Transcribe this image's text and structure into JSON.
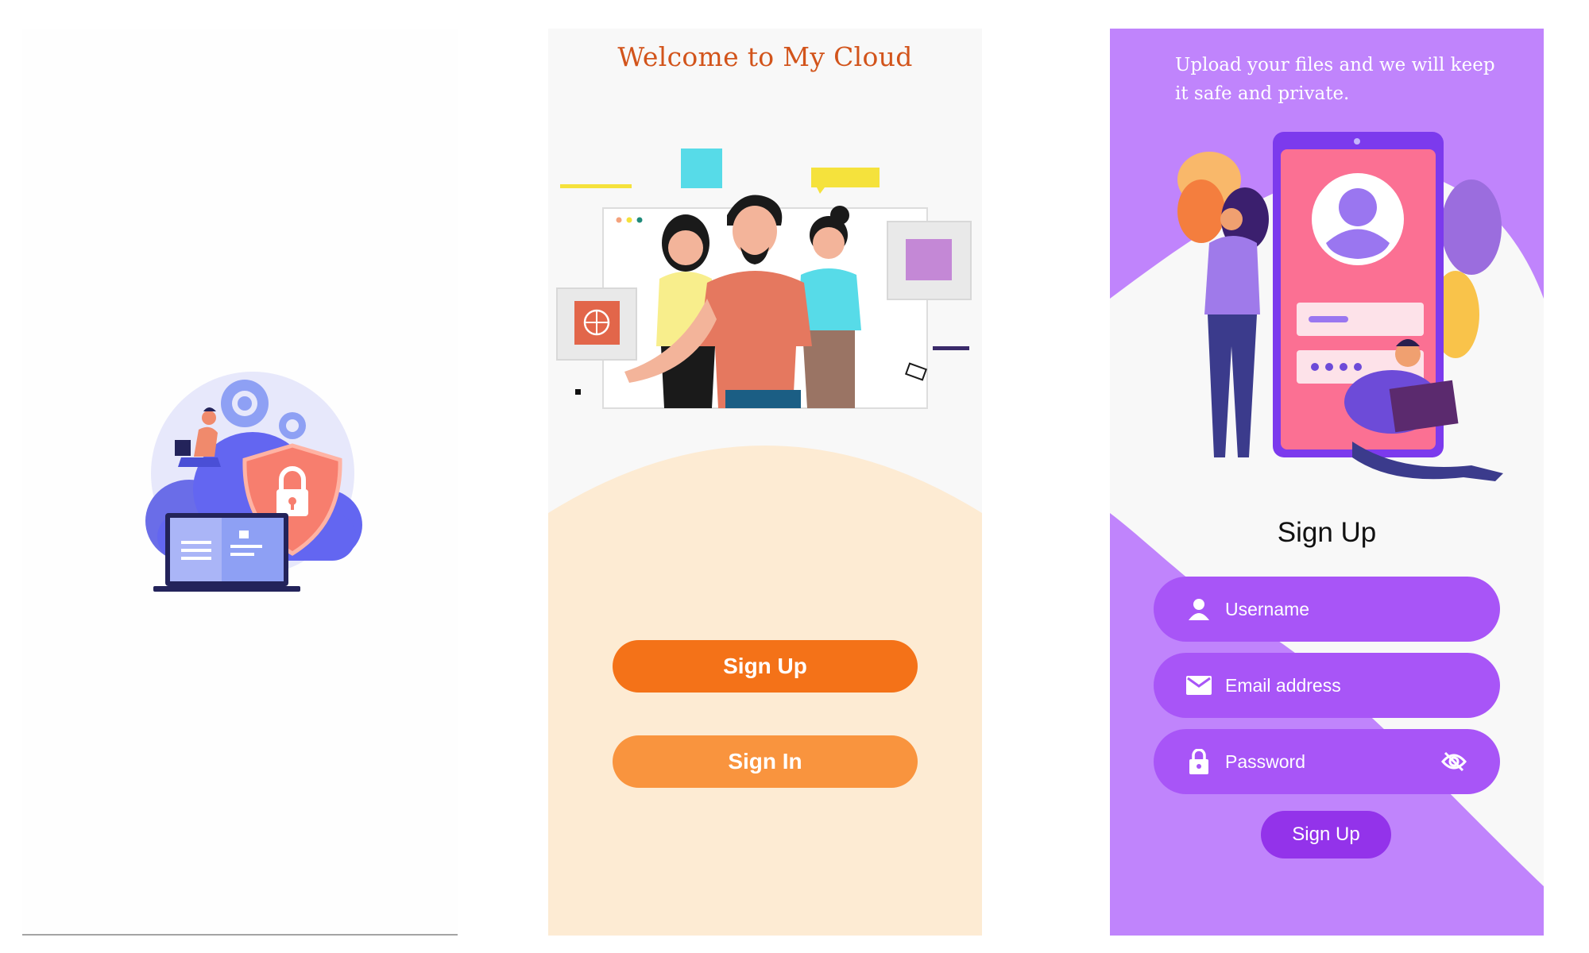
{
  "colors": {
    "splash_bg": "#fefefe",
    "welcome_title": "#d2541b",
    "welcome_arc": "#fdebd3",
    "signup_button_primary": "#f47218",
    "signin_button": "#f9943e",
    "signup_purple": "#c084fc",
    "field_purple": "#a855f7",
    "submit_purple": "#9333ea"
  },
  "welcome": {
    "title": "Welcome to My Cloud",
    "signup_label": "Sign Up",
    "signin_label": "Sign In"
  },
  "signup": {
    "tagline": "Upload your files and we will keep it safe and private.",
    "heading": "Sign Up",
    "username": {
      "placeholder": "Username",
      "icon": "person-icon"
    },
    "email": {
      "placeholder": "Email address",
      "icon": "mail-icon"
    },
    "password": {
      "placeholder": "Password",
      "icon": "lock-icon",
      "toggle_icon": "eye-off-icon"
    },
    "submit_label": "Sign Up"
  }
}
